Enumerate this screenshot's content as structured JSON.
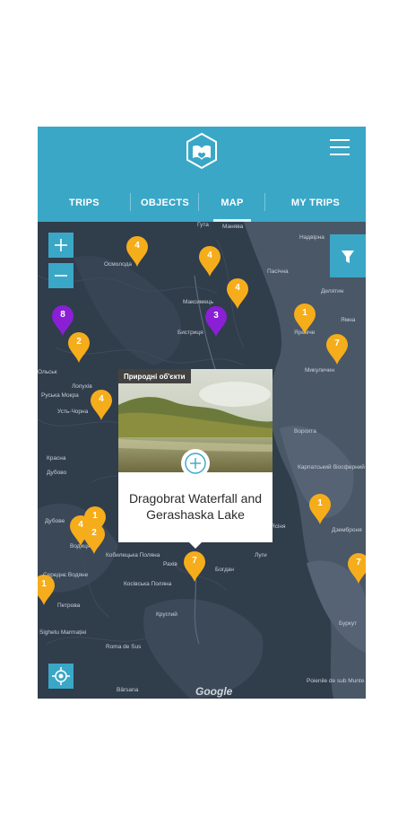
{
  "header": {
    "logo_icon": "book-heart-hexagon-icon",
    "menu_icon": "hamburger-menu-icon",
    "brand_color": "#3aa7c7"
  },
  "tabs": [
    {
      "label": "TRIPS",
      "active": false
    },
    {
      "label": "OBJECTS",
      "active": false
    },
    {
      "label": "MAP",
      "active": true
    },
    {
      "label": "MY TRIPS",
      "active": false
    }
  ],
  "map": {
    "controls": {
      "zoom_in": "+",
      "zoom_out": "−",
      "filter_icon": "filter-funnel-icon",
      "locate_icon": "gps-crosshair-icon"
    },
    "pin_colors": {
      "object": "#f5ad1b",
      "trip": "#8a1fd6"
    },
    "pins": [
      {
        "label": "4",
        "type": "object"
      },
      {
        "label": "4",
        "type": "object"
      },
      {
        "label": "4",
        "type": "object"
      },
      {
        "label": "8",
        "type": "trip"
      },
      {
        "label": "3",
        "type": "trip"
      },
      {
        "label": "2",
        "type": "object"
      },
      {
        "label": "1",
        "type": "object"
      },
      {
        "label": "7",
        "type": "object"
      },
      {
        "label": "4",
        "type": "object"
      },
      {
        "label": "1",
        "type": "object"
      },
      {
        "label": "4",
        "type": "object"
      },
      {
        "label": "2",
        "type": "object"
      },
      {
        "label": "7",
        "type": "object"
      },
      {
        "label": "1",
        "type": "object"
      },
      {
        "label": "7",
        "type": "object"
      },
      {
        "label": "1",
        "type": "object"
      }
    ],
    "places": [
      "Гута",
      "Манява",
      "Осмолода",
      "Пасічна",
      "Надвірна",
      "Максимець",
      "Делятин",
      "Бистриця",
      "Ямна",
      "Яремче",
      "Микуличин",
      "Ворохта",
      "Луги",
      "Рахів",
      "Богдан",
      "Кобилецька Поляна",
      "Косівська Поляна",
      "Круглий",
      "Roma de Sus",
      "Bârsana",
      "Петрова",
      "Sighetu Marmației",
      "Середнє Водяне",
      "Водиця",
      "Дубове",
      "Красна",
      "Руська Мокра",
      "Лопухів",
      "Усть-Чорна",
      "Карпатський біосферний",
      "Дземброня",
      "Буркут",
      "Poienile de sub Munte",
      "Ольськ",
      "Ясіня",
      "Дубово"
    ],
    "attribution": "Google"
  },
  "popup": {
    "category": "Природні об'єкти",
    "title": "Dragobrat Waterfall and Gerashaska Lake",
    "add_icon": "plus-circle-icon"
  }
}
